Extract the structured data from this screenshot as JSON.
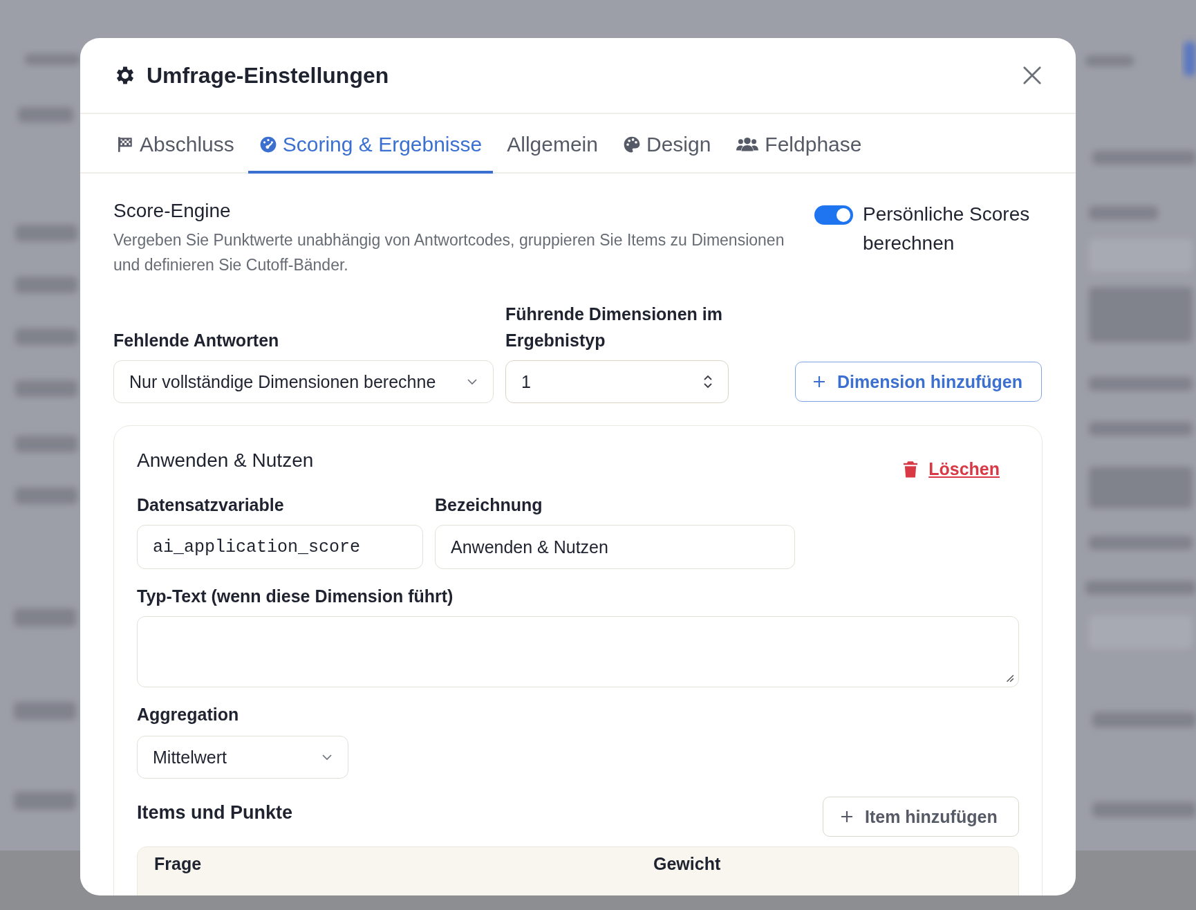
{
  "dialog": {
    "title": "Umfrage-Einstellungen"
  },
  "tabs": [
    {
      "label": "Abschluss",
      "selected": false
    },
    {
      "label": "Scoring & Ergebnisse",
      "selected": true
    },
    {
      "label": "Allgemein",
      "selected": false
    },
    {
      "label": "Design",
      "selected": false
    },
    {
      "label": "Feldphase",
      "selected": false
    }
  ],
  "score_engine": {
    "title": "Score-Engine",
    "description": "Vergeben Sie Punktwerte unabhängig von Antwortcodes, gruppieren Sie Items zu Dimensionen und definieren Sie Cutoff-Bänder.",
    "toggle": {
      "label": "Persönliche Scores berechnen",
      "on": true
    }
  },
  "missing_answers": {
    "label": "Fehlende Antworten",
    "value": "Nur vollständige Dimensionen berechne"
  },
  "leading_dimensions": {
    "label": "Führende Dimensionen im Ergebnistyp",
    "value": "1"
  },
  "add_dimension": "Dimension hinzufügen",
  "dimension": {
    "title": "Anwenden & Nutzen",
    "delete": "Löschen",
    "variable": {
      "label": "Datensatzvariable",
      "value": "ai_application_score"
    },
    "name": {
      "label": "Bezeichnung",
      "value": "Anwenden & Nutzen"
    },
    "type_text": {
      "label": "Typ-Text (wenn diese Dimension führt)"
    },
    "aggregation": {
      "label": "Aggregation",
      "value": "Mittelwert"
    },
    "items": {
      "title": "Items und Punkte",
      "add": "Item hinzufügen",
      "columns": [
        "Frage",
        "Gewicht"
      ]
    }
  }
}
